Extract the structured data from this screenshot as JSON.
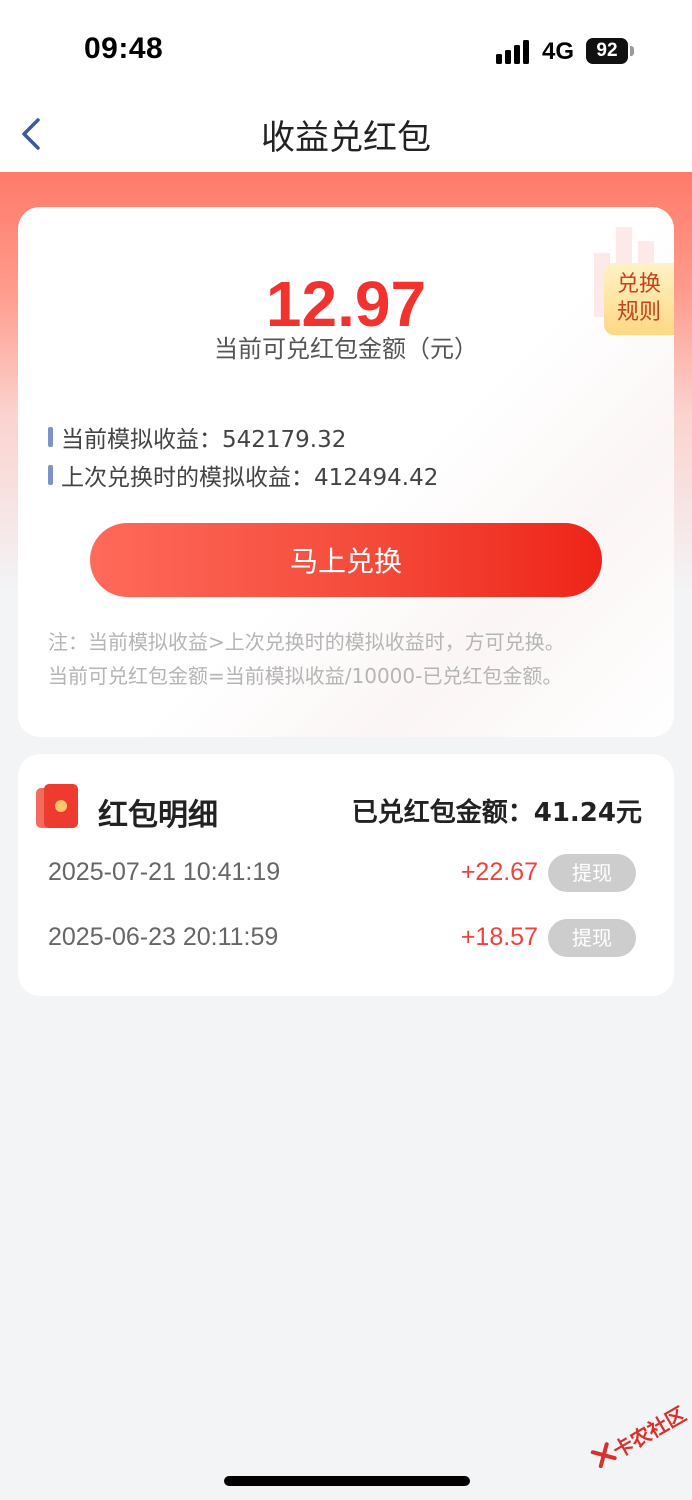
{
  "status_bar": {
    "time": "09:48",
    "network": "4G",
    "battery": "92"
  },
  "nav": {
    "title": "收益兑红包"
  },
  "summary": {
    "amount": "12.97",
    "amount_label": "当前可兑红包金额（元）",
    "rules_badge_line1": "兑换",
    "rules_badge_line2": "规则",
    "current_earnings": "当前模拟收益：542179.32",
    "last_earnings": "上次兑换时的模拟收益：412494.42",
    "exchange_button": "马上兑换",
    "note_line1": "注：当前模拟收益>上次兑换时的模拟收益时，方可兑换。",
    "note_line2": "当前可兑红包金额=当前模拟收益/10000-已兑红包金额。"
  },
  "details": {
    "title": "红包明细",
    "total": "已兑红包金额：41.24元",
    "rows": [
      {
        "date": "2025-07-21 10:41:19",
        "amount": "+22.67",
        "action": "提现"
      },
      {
        "date": "2025-06-23 20:11:59",
        "amount": "+18.57",
        "action": "提现"
      }
    ]
  },
  "watermark": "卡农社区",
  "colors": {
    "primary_red": "#f2322e",
    "button_gradient_start": "#ff6a5a",
    "button_gradient_end": "#ee2418",
    "badge_gold": "#ffd884",
    "page_bg": "#f3f4f6"
  }
}
